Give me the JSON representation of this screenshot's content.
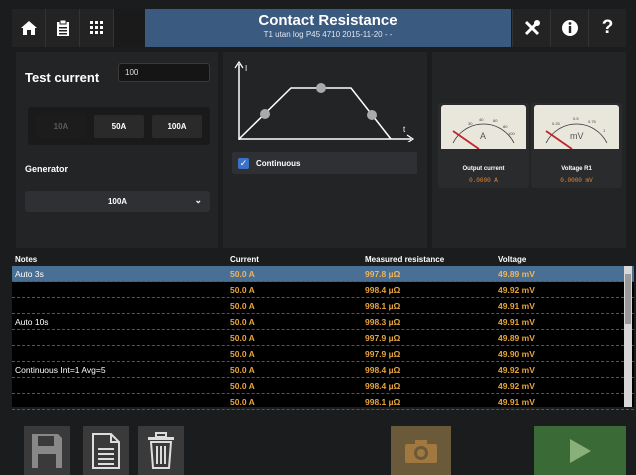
{
  "header": {
    "title": "Contact Resistance",
    "subtitle": "T1 utan log P45 4710 2015-11-20 - -"
  },
  "test_current": {
    "label": "Test current",
    "value": "100",
    "buttons": [
      {
        "label": "10A",
        "enabled": false
      },
      {
        "label": "50A",
        "enabled": true
      },
      {
        "label": "100A",
        "enabled": true
      }
    ]
  },
  "generator": {
    "label": "Generator",
    "selected": "100A"
  },
  "waveform": {
    "y_axis": "I",
    "x_axis": "t",
    "continuous_label": "Continuous",
    "continuous_checked": true
  },
  "meters": [
    {
      "unit": "A",
      "name": "Output current",
      "value": "0.0000 A",
      "scale": [
        "30",
        "40",
        "50",
        "60",
        "70",
        "80",
        "90",
        "100"
      ]
    },
    {
      "unit": "mV",
      "name": "Voltage R1",
      "value": "0.0000 mV",
      "scale": [
        "0.25",
        "0.5",
        "0.75",
        "1"
      ]
    }
  ],
  "table": {
    "headers": [
      "Notes",
      "Current",
      "Measured resistance",
      "Voltage"
    ],
    "rows": [
      {
        "notes": "Auto 3s",
        "current": "50.0 A",
        "resistance": "997.8 µΩ",
        "voltage": "49.89 mV",
        "selected": true
      },
      {
        "notes": "",
        "current": "50.0 A",
        "resistance": "998.4 µΩ",
        "voltage": "49.92 mV"
      },
      {
        "notes": "",
        "current": "50.0 A",
        "resistance": "998.1 µΩ",
        "voltage": "49.91 mV"
      },
      {
        "notes": "Auto 10s",
        "current": "50.0 A",
        "resistance": "998.3 µΩ",
        "voltage": "49.91 mV"
      },
      {
        "notes": "",
        "current": "50.0 A",
        "resistance": "997.9 µΩ",
        "voltage": "49.89 mV"
      },
      {
        "notes": "",
        "current": "50.0 A",
        "resistance": "997.9 µΩ",
        "voltage": "49.90 mV"
      },
      {
        "notes": "Continuous Int=1 Avg=5",
        "current": "50.0 A",
        "resistance": "998.4 µΩ",
        "voltage": "49.92 mV"
      },
      {
        "notes": "",
        "current": "50.0 A",
        "resistance": "998.4 µΩ",
        "voltage": "49.92 mV"
      },
      {
        "notes": "",
        "current": "50.0 A",
        "resistance": "998.1 µΩ",
        "voltage": "49.91 mV"
      }
    ]
  },
  "colors": {
    "accent": "#3a5a80",
    "value_orange": "#e8a53c",
    "selected_row": "#4a6f95",
    "start_green": "#3a6a36"
  }
}
